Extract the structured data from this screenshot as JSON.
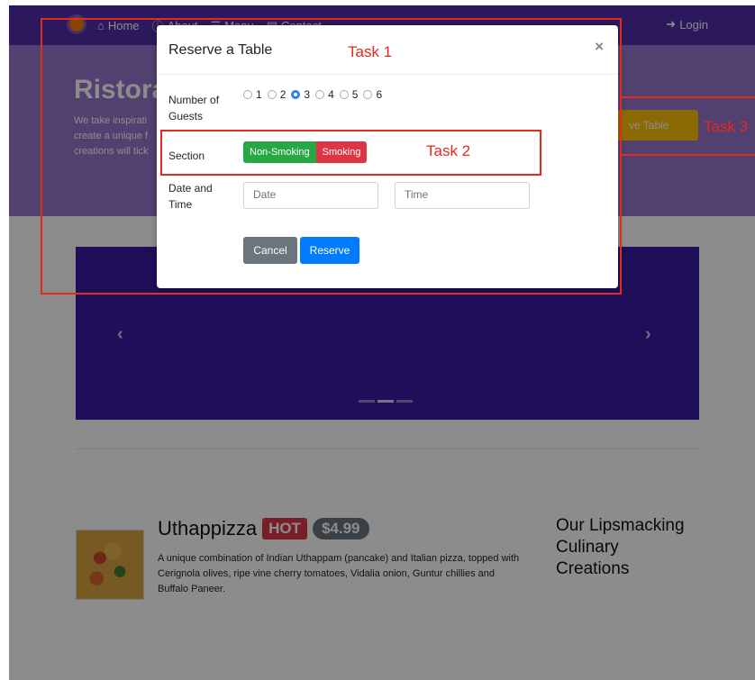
{
  "navbar": {
    "links": [
      {
        "icon": "home-icon",
        "label": "Home"
      },
      {
        "icon": "info-icon",
        "label": "About"
      },
      {
        "icon": "list-icon",
        "label": "Menu"
      },
      {
        "icon": "address-card-icon",
        "label": "Contact"
      }
    ],
    "login_label": "Login"
  },
  "jumbotron": {
    "title_visible": "Ristora",
    "text_visible": "We take inspirati\ncreate a unique f\ncreations will tick",
    "reserve_visible": "ve Table"
  },
  "dish": {
    "name": "Uthappizza",
    "badge_hot": "HOT",
    "price": "$4.99",
    "description": "A unique combination of Indian Uthappam (pancake) and Italian pizza, topped with Cerignola olives, ripe vine cherry tomatoes, Vidalia onion, Guntur chillies and Buffalo Paneer."
  },
  "side_heading": "Our Lipsmacking Culinary Creations",
  "modal": {
    "title": "Reserve a Table",
    "close_glyph": "×",
    "guests_label": "Number of Guests",
    "guest_options": [
      "1",
      "2",
      "3",
      "4",
      "5",
      "6"
    ],
    "guests_selected": "3",
    "section_label": "Section",
    "section_options": [
      "Non-Smoking",
      "Smoking"
    ],
    "datetime_label": "Date and Time",
    "date_placeholder": "Date",
    "time_placeholder": "Time",
    "cancel_label": "Cancel",
    "reserve_label": "Reserve"
  },
  "annotations": {
    "task1": "Task 1",
    "task2": "Task 2",
    "task3": "Task 3"
  },
  "colors": {
    "primary_purple": "#512da8",
    "light_purple": "#9575cd",
    "carousel_purple": "#3a1aa4",
    "amber": "#ffc107",
    "success": "#28a745",
    "danger": "#dc3545",
    "secondary": "#6c757d",
    "primary_blue": "#007bff",
    "annotation_red": "#e32a1c"
  }
}
